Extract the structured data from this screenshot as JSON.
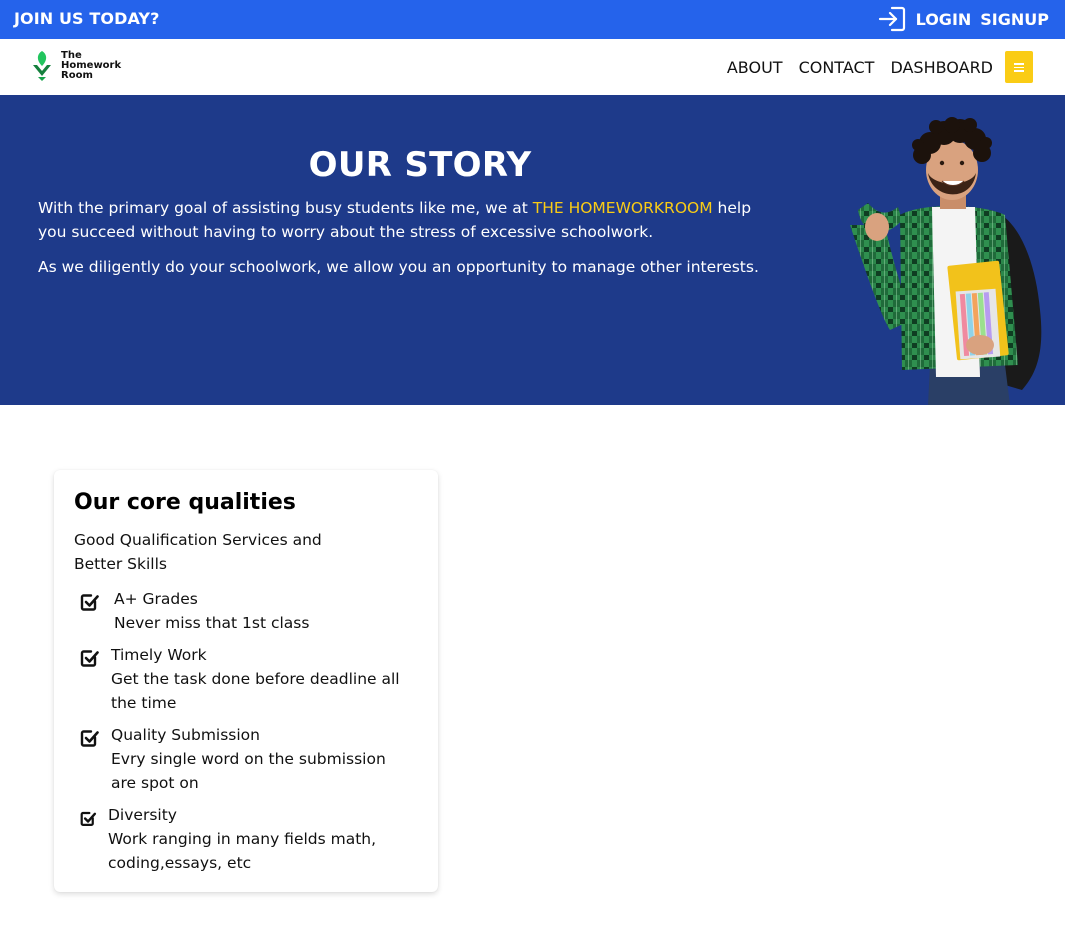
{
  "topbar": {
    "join_text": "JOIN US TODAY?",
    "login_label": "LOGIN",
    "signup_label": "SIGNUP",
    "background": "#2563eb"
  },
  "nav": {
    "logo_lines": [
      "The",
      "Homework",
      "Room"
    ],
    "links": [
      "ABOUT",
      "CONTACT",
      "DASHBOARD"
    ],
    "menu_icon": "hamburger-icon",
    "menu_color": "#facc15"
  },
  "hero": {
    "title": "OUR STORY",
    "p1_before": "With the primary goal of assisting busy students like me, we at ",
    "p1_highlight": "THE HOMEWORKROOM",
    "p1_after": " help you succeed without having to worry about the stress of excessive schoolwork.",
    "p2": "As we diligently do your schoolwork, we allow you an opportunity to manage other interests.",
    "background": "#1e3a8a",
    "highlight_color": "#facc15"
  },
  "qualities": {
    "title": "Our core qualities",
    "subtitle": "Good Qualification Services and Better Skills",
    "items": [
      {
        "title": "A+ Grades",
        "desc": "Never miss that 1st class"
      },
      {
        "title": "Timely Work",
        "desc": "Get the task done before deadline all the time"
      },
      {
        "title": "Quality Submission",
        "desc": "Evry single word on the submission are spot on"
      },
      {
        "title": "Diversity",
        "desc": "Work ranging in many fields math, coding,essays, etc"
      }
    ]
  }
}
